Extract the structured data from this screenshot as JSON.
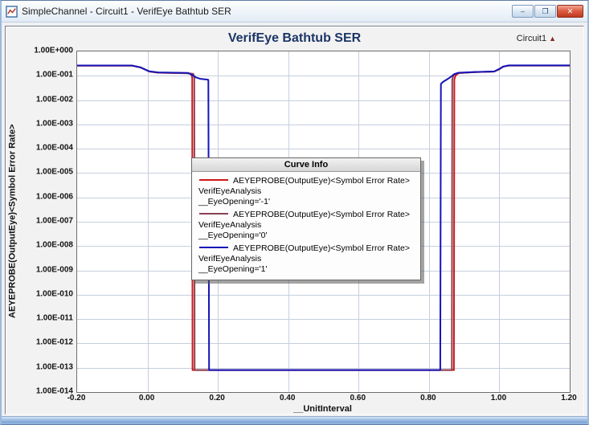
{
  "window": {
    "title": "SimpleChannel - Circuit1 - VerifEye Bathtub SER",
    "controls": {
      "minimize": "–",
      "maximize": "❒",
      "close": "✕"
    }
  },
  "chart": {
    "title": "VerifEye Bathtub SER",
    "corner_label": "Circuit1",
    "corner_marker": "▲",
    "x_axis": {
      "title": "__UnitInterval",
      "ticks": [
        "-0.20",
        "0.00",
        "0.20",
        "0.40",
        "0.60",
        "0.80",
        "1.00",
        "1.20"
      ]
    },
    "y_axis": {
      "title": "AEYEPROBE(OutputEye)<Symbol Error Rate>",
      "ticks": [
        "1.00E+000",
        "1.00E-001",
        "1.00E-002",
        "1.00E-003",
        "1.00E-004",
        "1.00E-005",
        "1.00E-006",
        "1.00E-007",
        "1.00E-008",
        "1.00E-009",
        "1.00E-010",
        "1.00E-011",
        "1.00E-012",
        "1.00E-013",
        "1.00E-014"
      ]
    },
    "legend": {
      "title": "Curve Info",
      "entries": [
        {
          "color": "#d01818",
          "lines": [
            "AEYEPROBE(OutputEye)<Symbol Error Rate>",
            "VerifEyeAnalysis",
            "__EyeOpening='-1'"
          ]
        },
        {
          "color": "#8b4152",
          "lines": [
            "AEYEPROBE(OutputEye)<Symbol Error Rate>",
            "VerifEyeAnalysis",
            "__EyeOpening='0'"
          ]
        },
        {
          "color": "#1414b8",
          "lines": [
            "AEYEPROBE(OutputEye)<Symbol Error Rate>",
            "VerifEyeAnalysis",
            "__EyeOpening='1'"
          ]
        }
      ]
    }
  },
  "chart_data": {
    "type": "line",
    "title": "VerifEye Bathtub SER",
    "xlabel": "__UnitInterval",
    "ylabel": "AEYEPROBE(OutputEye)<Symbol Error Rate>",
    "xlim": [
      -0.2,
      1.2
    ],
    "ylim": [
      1e-14,
      1
    ],
    "ylog": true,
    "grid": true,
    "gridline_color": "#c6cfde",
    "legend_position": "center",
    "series": [
      {
        "name": "__EyeOpening='-1'",
        "color": "#d01818",
        "width": 2,
        "points": [
          [
            -0.2,
            0.26
          ],
          [
            -0.045,
            0.26
          ],
          [
            -0.02,
            0.22
          ],
          [
            0.005,
            0.15
          ],
          [
            0.03,
            0.133
          ],
          [
            0.115,
            0.126
          ],
          [
            0.124,
            0.118
          ],
          [
            0.127,
            0.085
          ],
          [
            0.128,
            8e-14
          ],
          [
            0.871,
            8e-14
          ],
          [
            0.872,
            0.07
          ],
          [
            0.876,
            0.105
          ],
          [
            0.885,
            0.128
          ],
          [
            0.93,
            0.141
          ],
          [
            0.985,
            0.148
          ],
          [
            1.0,
            0.185
          ],
          [
            1.01,
            0.235
          ],
          [
            1.025,
            0.262
          ],
          [
            1.2,
            0.262
          ]
        ]
      },
      {
        "name": "__EyeOpening='0'",
        "color": "#8b4152",
        "width": 2,
        "points": [
          [
            -0.2,
            0.262
          ],
          [
            -0.045,
            0.262
          ],
          [
            -0.02,
            0.22
          ],
          [
            0.005,
            0.15
          ],
          [
            0.03,
            0.134
          ],
          [
            0.115,
            0.127
          ],
          [
            0.13,
            0.12
          ],
          [
            0.133,
            0.085
          ],
          [
            0.134,
            8e-14
          ],
          [
            0.865,
            8e-14
          ],
          [
            0.866,
            0.07
          ],
          [
            0.87,
            0.105
          ],
          [
            0.88,
            0.128
          ],
          [
            0.93,
            0.142
          ],
          [
            0.985,
            0.149
          ],
          [
            1.0,
            0.186
          ],
          [
            1.01,
            0.236
          ],
          [
            1.025,
            0.263
          ],
          [
            1.2,
            0.263
          ]
        ]
      },
      {
        "name": "__EyeOpening='1'",
        "color": "#1414b8",
        "width": 2,
        "points": [
          [
            -0.2,
            0.265
          ],
          [
            -0.045,
            0.265
          ],
          [
            -0.02,
            0.222
          ],
          [
            0.005,
            0.152
          ],
          [
            0.03,
            0.137
          ],
          [
            0.115,
            0.13
          ],
          [
            0.128,
            0.105
          ],
          [
            0.138,
            0.085
          ],
          [
            0.15,
            0.075
          ],
          [
            0.168,
            0.07
          ],
          [
            0.173,
            0.068
          ],
          [
            0.175,
            8e-14
          ],
          [
            0.832,
            8e-14
          ],
          [
            0.834,
            0.046
          ],
          [
            0.84,
            0.056
          ],
          [
            0.852,
            0.072
          ],
          [
            0.862,
            0.09
          ],
          [
            0.872,
            0.118
          ],
          [
            0.885,
            0.133
          ],
          [
            0.93,
            0.143
          ],
          [
            0.985,
            0.15
          ],
          [
            1.0,
            0.19
          ],
          [
            1.012,
            0.24
          ],
          [
            1.027,
            0.266
          ],
          [
            1.2,
            0.266
          ]
        ]
      }
    ]
  }
}
